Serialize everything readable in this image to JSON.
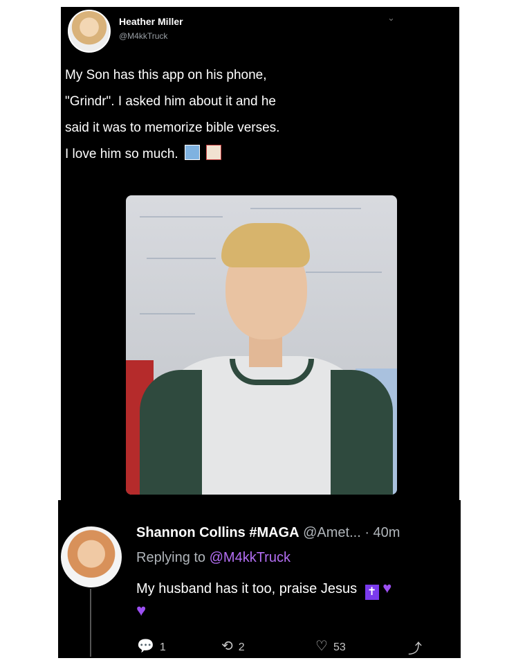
{
  "tweet": {
    "author_name": "Heather Miller",
    "author_handle": "@M4kkTruck",
    "line1": "My Son has this app on his phone,",
    "line2": "\"Grindr\". I asked him about it and he",
    "line3": "said it was to memorize bible verses.",
    "line4": "I love him so much."
  },
  "reply": {
    "author_name": "Shannon Collins #MAGA",
    "author_handle": "@Amet... · 40m",
    "replying_prefix": "Replying to",
    "replying_mention": "@M4kkTruck",
    "text": "My husband has it too, praise Jesus",
    "counts": {
      "replies": "1",
      "retweets": "2",
      "likes": "53"
    }
  },
  "icons": [
    "chevron-down-icon",
    "reply-icon",
    "retweet-icon",
    "like-icon",
    "share-icon",
    "cross-icon",
    "purple-heart-icon"
  ],
  "colors": {
    "mention": "#b36ef3",
    "heart": "#9c4ff2"
  }
}
